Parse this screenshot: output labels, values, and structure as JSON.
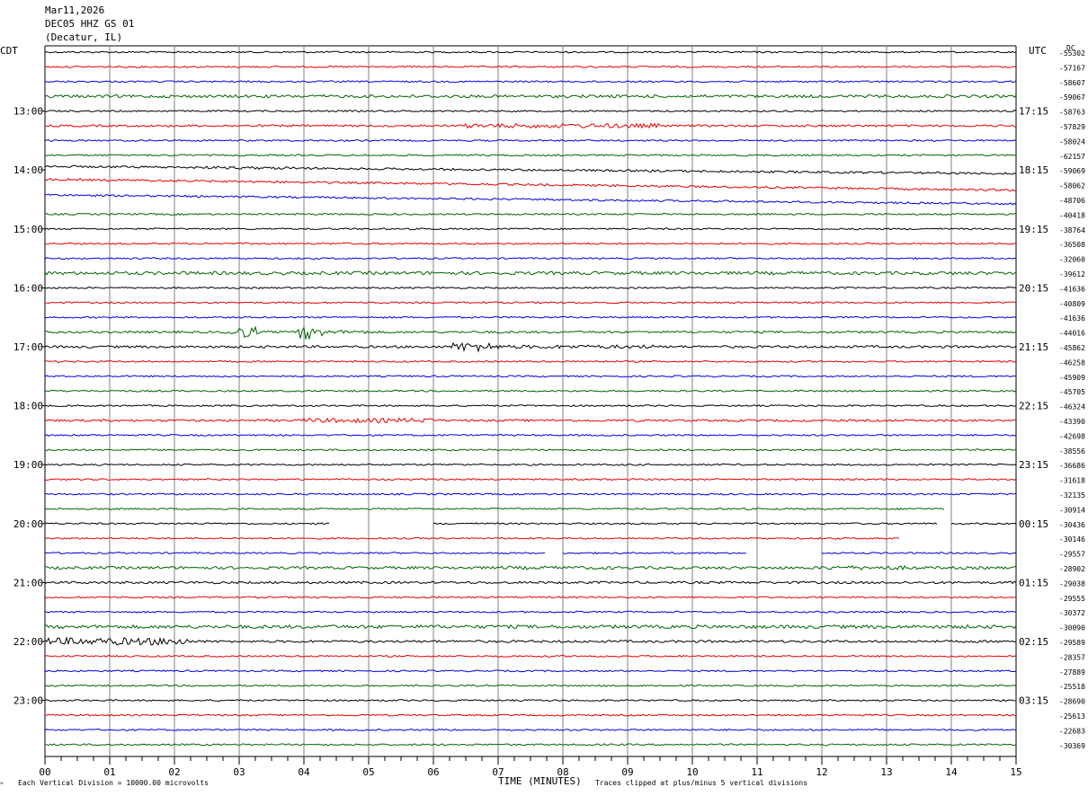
{
  "header": {
    "date": "Mar11,2026",
    "station": "DEC05 HHZ GS 01",
    "location": "(Decatur, IL)"
  },
  "left_tz": "CDT",
  "right_tz": "UTC",
  "dc_label": "DC",
  "left_hours": [
    "13:00",
    "14:00",
    "15:00",
    "16:00",
    "17:00",
    "18:00",
    "19:00",
    "20:00",
    "21:00",
    "22:00",
    "23:00"
  ],
  "right_hours": [
    "17:15",
    "18:15",
    "19:15",
    "20:15",
    "21:15",
    "22:15",
    "23:15",
    "00:15",
    "01:15",
    "02:15",
    "03:15"
  ],
  "footer": {
    "scale_note": "Each Vertical Division = 10000.00 microvolts",
    "x_title": "TIME (MINUTES)",
    "clip_note": "Traces clipped at plus/minus 5 vertical divisions"
  },
  "colors": {
    "trace_cycle": [
      "#000000",
      "#e60000",
      "#0000e6",
      "#006400"
    ],
    "grid": "#808080"
  },
  "chart_data": {
    "type": "line",
    "title": "DEC05 HHZ GS 01",
    "xlabel": "TIME (MINUTES)",
    "x_ticks": [
      "00",
      "01",
      "02",
      "03",
      "04",
      "05",
      "06",
      "07",
      "08",
      "09",
      "10",
      "11",
      "12",
      "13",
      "14",
      "15"
    ],
    "xlim": [
      0,
      15
    ],
    "scale_microvolts_per_division": 10000,
    "dc_offsets": [
      "-55302",
      "-57167",
      "-58607",
      "-59067",
      "-58763",
      "-57829",
      "-58024",
      "-62157",
      "-59069",
      "-58062",
      "-48706",
      "-40418",
      "-38764",
      "-36508",
      "-32060",
      "-39612",
      "-41636",
      "-40809",
      "-41636",
      "-44016",
      "-45862",
      "-46258",
      "-45909",
      "-45705",
      "-46324",
      "-43390",
      "-42698",
      "-38556",
      "-36686",
      "-31618",
      "-32135",
      "-30914",
      "-30436",
      "-30146",
      "-29557",
      "-28902",
      "-29038",
      "-29555",
      "-30372",
      "-30090",
      "-29589",
      "-28357",
      "-27889",
      "-25518",
      "-28690",
      "-25613",
      "-22683",
      "-30369"
    ],
    "traces_count": 48,
    "minutes_per_trace": 15
  }
}
